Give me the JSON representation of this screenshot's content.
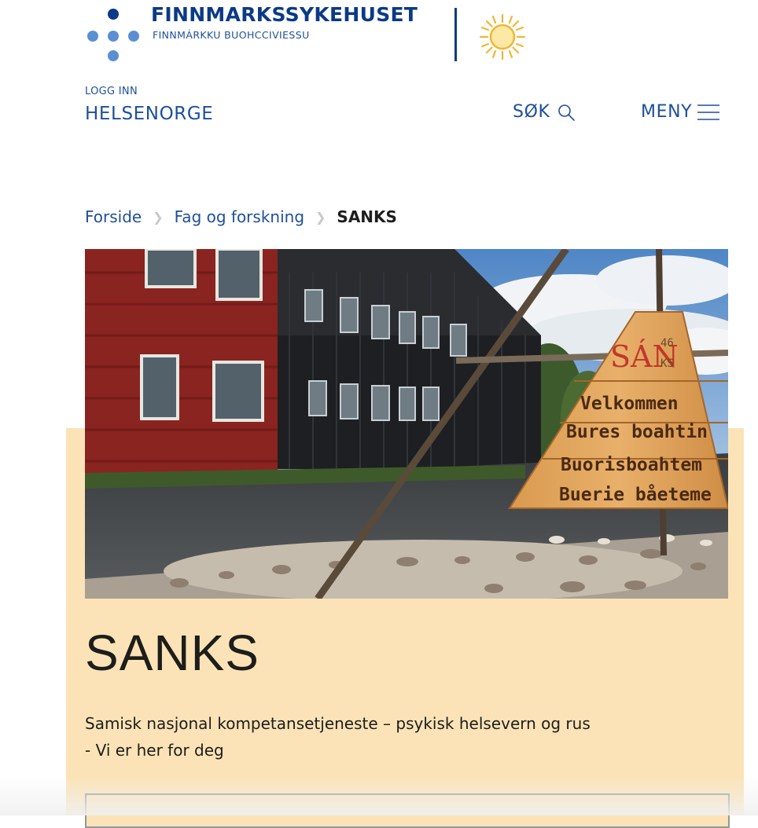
{
  "header": {
    "org_name": "FINNMARKSSYKEHUSET",
    "org_subtitle": "FINNMÁRKKU BUOHCCIVIESSU"
  },
  "login": {
    "small_label": "LOGG INN",
    "big_label": "HELSENORGE"
  },
  "nav": {
    "search_label": "SØK",
    "menu_label": "MENY"
  },
  "breadcrumb": {
    "items": [
      "Forside",
      "Fag og forskning"
    ],
    "current": "SANKS"
  },
  "hero": {
    "sign": {
      "logo_text": "SÁN",
      "logo_suffix_top": "46",
      "logo_suffix_bottom": "KS",
      "lines": [
        "Velkommen",
        "Bures boahtin",
        "Buorisboahtem",
        "Buerie båeteme"
      ]
    },
    "title": "SANKS",
    "description_line1": "Samisk nasjonal kompetansetjeneste – psykisk helsevern og rus",
    "description_line2": "- Vi er her for deg"
  },
  "colors": {
    "brand_blue": "#0b3a86",
    "link_blue": "#1e4f9c",
    "hero_background": "#fbe3b7",
    "logo_dot_light": "#5b8fd3",
    "logo_dot_dark": "#0b3a86",
    "sun_yellow": "#f2b632"
  },
  "icons": {
    "logo": "hospital-dots-logo",
    "sun": "sun-logo",
    "search": "search-icon",
    "menu": "hamburger-menu-icon"
  }
}
